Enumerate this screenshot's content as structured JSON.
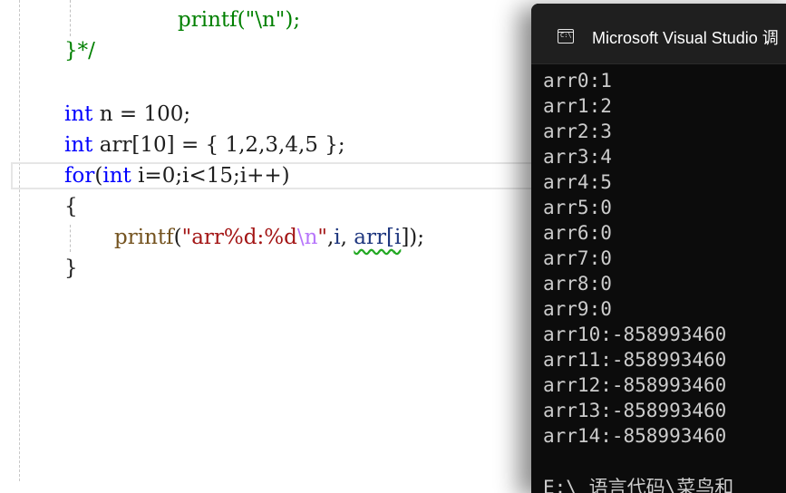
{
  "editor": {
    "lines": {
      "printf_newline": {
        "fn": "printf",
        "open": "(",
        "q1": "\"",
        "esc": "\\n",
        "q2": "\"",
        "close": ");"
      },
      "comment_end": {
        "text": "}*/"
      },
      "int_n": {
        "kw": "int",
        "rest": " n = 100;"
      },
      "int_arr": {
        "kw": "int",
        "rest": " arr[10] = { 1,2,3,4,5 };"
      },
      "for_loop": {
        "kw_for": "for",
        "p1": "(",
        "kw_int": "int",
        "rest": " i=0;i<15;i++)"
      },
      "open_brace": {
        "text": "{"
      },
      "printf_arr": {
        "fn": "printf",
        "open": "(",
        "str": "\"arr%d:%d",
        "esc": "\\n",
        "q": "\"",
        "comma": ",",
        "var_i": "i",
        "comma2": ", ",
        "arr": "arr[",
        "idx": "i",
        "close": "]);"
      },
      "close_brace": {
        "text": "}"
      }
    }
  },
  "console": {
    "title": "Microsoft Visual Studio 调",
    "icon": "console-app-icon",
    "output": [
      "arr0:1",
      "arr1:2",
      "arr2:3",
      "arr3:4",
      "arr4:5",
      "arr5:0",
      "arr6:0",
      "arr7:0",
      "arr8:0",
      "arr9:0",
      "arr10:-858993460",
      "arr11:-858993460",
      "arr12:-858993460",
      "arr13:-858993460",
      "arr14:-858993460"
    ],
    "tail_text": "E:\\ 语言代码\\菜鸟和"
  },
  "colors": {
    "keyword": "#0000ff",
    "string": "#a31515",
    "escape": "#b776fb",
    "function": "#74531f",
    "variable": "#1f377f",
    "comment": "#008000",
    "console_bg": "#0c0c0c",
    "console_text": "#cccccc"
  }
}
